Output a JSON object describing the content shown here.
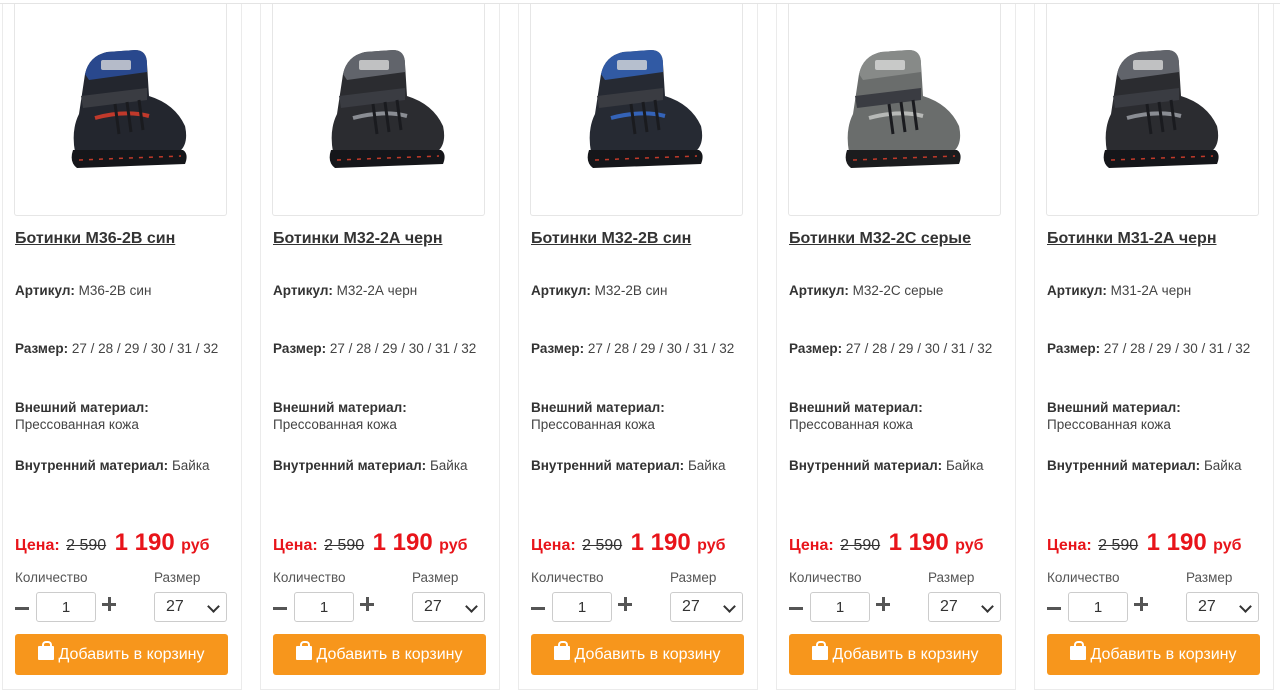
{
  "labels": {
    "article": "Артикул:",
    "size": "Размер:",
    "outer_material": "Внешний материал:",
    "inner_material": "Внутренний материал:",
    "price": "Цена:",
    "currency": "руб",
    "quantity": "Количество",
    "size_select": "Размер",
    "add_to_cart": "Добавить в корзину"
  },
  "colors": {
    "accent": "#f7961c",
    "price_red": "#e8141a"
  },
  "products": [
    {
      "name": "Ботинки М36-2В син",
      "article": "М36-2В син",
      "sizes": "27 / 28 / 29 / 30 / 31 / 32",
      "outer_material": "Прессованная кожа",
      "inner_material": "Байка",
      "old_price": "2 590",
      "new_price": "1 190",
      "quantity": "1",
      "selected_size": "27",
      "image_icon": "boot-navy-icon"
    },
    {
      "name": "Ботинки М32-2А черн",
      "article": "М32-2А черн",
      "sizes": "27 / 28 / 29 / 30 / 31 / 32",
      "outer_material": "Прессованная кожа",
      "inner_material": "Байка",
      "old_price": "2 590",
      "new_price": "1 190",
      "quantity": "1",
      "selected_size": "27",
      "image_icon": "boot-black-icon"
    },
    {
      "name": "Ботинки М32-2В син",
      "article": "М32-2В син",
      "sizes": "27 / 28 / 29 / 30 / 31 / 32",
      "outer_material": "Прессованная кожа",
      "inner_material": "Байка",
      "old_price": "2 590",
      "new_price": "1 190",
      "quantity": "1",
      "selected_size": "27",
      "image_icon": "boot-blue-icon"
    },
    {
      "name": "Ботинки М32-2С серые",
      "article": "М32-2С серые",
      "sizes": "27 / 28 / 29 / 30 / 31 / 32",
      "outer_material": "Прессованная кожа",
      "inner_material": "Байка",
      "old_price": "2 590",
      "new_price": "1 190",
      "quantity": "1",
      "selected_size": "27",
      "image_icon": "boot-grey-icon"
    },
    {
      "name": "Ботинки М31-2А черн",
      "article": "М31-2А черн",
      "sizes": "27 / 28 / 29 / 30 / 31 / 32",
      "outer_material": "Прессованная кожа",
      "inner_material": "Байка",
      "old_price": "2 590",
      "new_price": "1 190",
      "quantity": "1",
      "selected_size": "27",
      "image_icon": "boot-black-icon"
    }
  ]
}
